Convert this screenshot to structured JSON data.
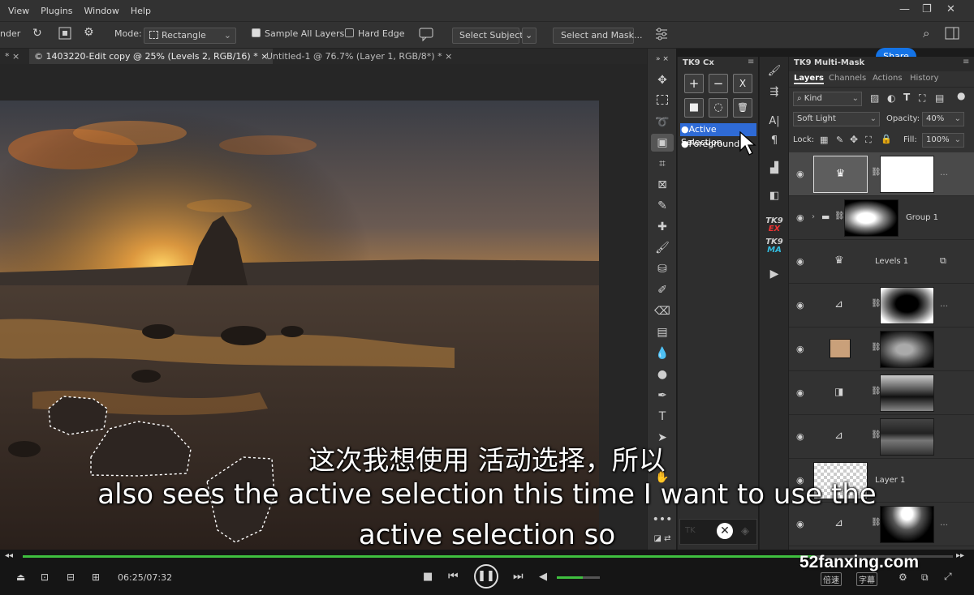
{
  "menu": [
    "View",
    "Plugins",
    "Window",
    "Help"
  ],
  "window_controls": {
    "minimize": "—",
    "restore": "❐",
    "close": "✕"
  },
  "options_bar": {
    "tool_name_fragment": "nder",
    "mode_label": "Mode:",
    "mode_value": "Rectangle",
    "sample_all_layers": "Sample All Layers",
    "hard_edge": "Hard Edge",
    "select_subject": "Select Subject",
    "select_and_mask": "Select and Mask...",
    "share": "Share"
  },
  "tabs": [
    {
      "label": "© 1403220-Edit copy @ 25% (Levels 2, RGB/16) *",
      "active": true
    },
    {
      "label": "Untitled-1 @ 76.7% (Layer 1, RGB/8*) *",
      "active": false
    }
  ],
  "tab_close": "×",
  "tk9_cx": {
    "title": "TK9 Cx",
    "buttons": [
      "+",
      "−",
      "X",
      "■",
      "◌",
      "🗑"
    ],
    "items": [
      "●Active Selection",
      "●Foreground"
    ]
  },
  "tk9_labels": {
    "ex": "EX",
    "ma": "MA",
    "tk9": "TK9"
  },
  "layers_panel": {
    "title": "TK9 Multi-Mask",
    "tabs": [
      "Layers",
      "Channels",
      "Actions",
      "History"
    ],
    "filter_kind": "Kind",
    "blend_mode": "Soft Light",
    "opacity_label": "Opacity:",
    "opacity": "40%",
    "lock_label": "Lock:",
    "fill_label": "Fill:",
    "fill": "100%",
    "layers": [
      {
        "name": "",
        "type": "levels-mask"
      },
      {
        "name": "Group 1",
        "type": "group"
      },
      {
        "name": "Levels 1",
        "type": "levels"
      },
      {
        "name": "",
        "type": "curves-mask"
      },
      {
        "name": "",
        "type": "solid-mask"
      },
      {
        "name": "",
        "type": "bw-mask"
      },
      {
        "name": "",
        "type": "curves-mask2"
      },
      {
        "name": "Layer 1",
        "type": "layer"
      },
      {
        "name": "",
        "type": "curves-mask3"
      }
    ]
  },
  "subtitles": {
    "cn": "这次我想使用 活动选择，所以",
    "en_line1": "also sees the active selection this time I want to use the",
    "en_line2": "active selection so"
  },
  "player": {
    "time": "06:25/07:32",
    "speed_label": "倍速",
    "subtitle_label": "字幕",
    "watermark": "52fanxing.com",
    "progress": 0.852,
    "volume": 0.6
  },
  "colors": {
    "accent": "#1473e6",
    "progress": "#3fbf3f",
    "selection_highlight": "#2f6bd6"
  }
}
